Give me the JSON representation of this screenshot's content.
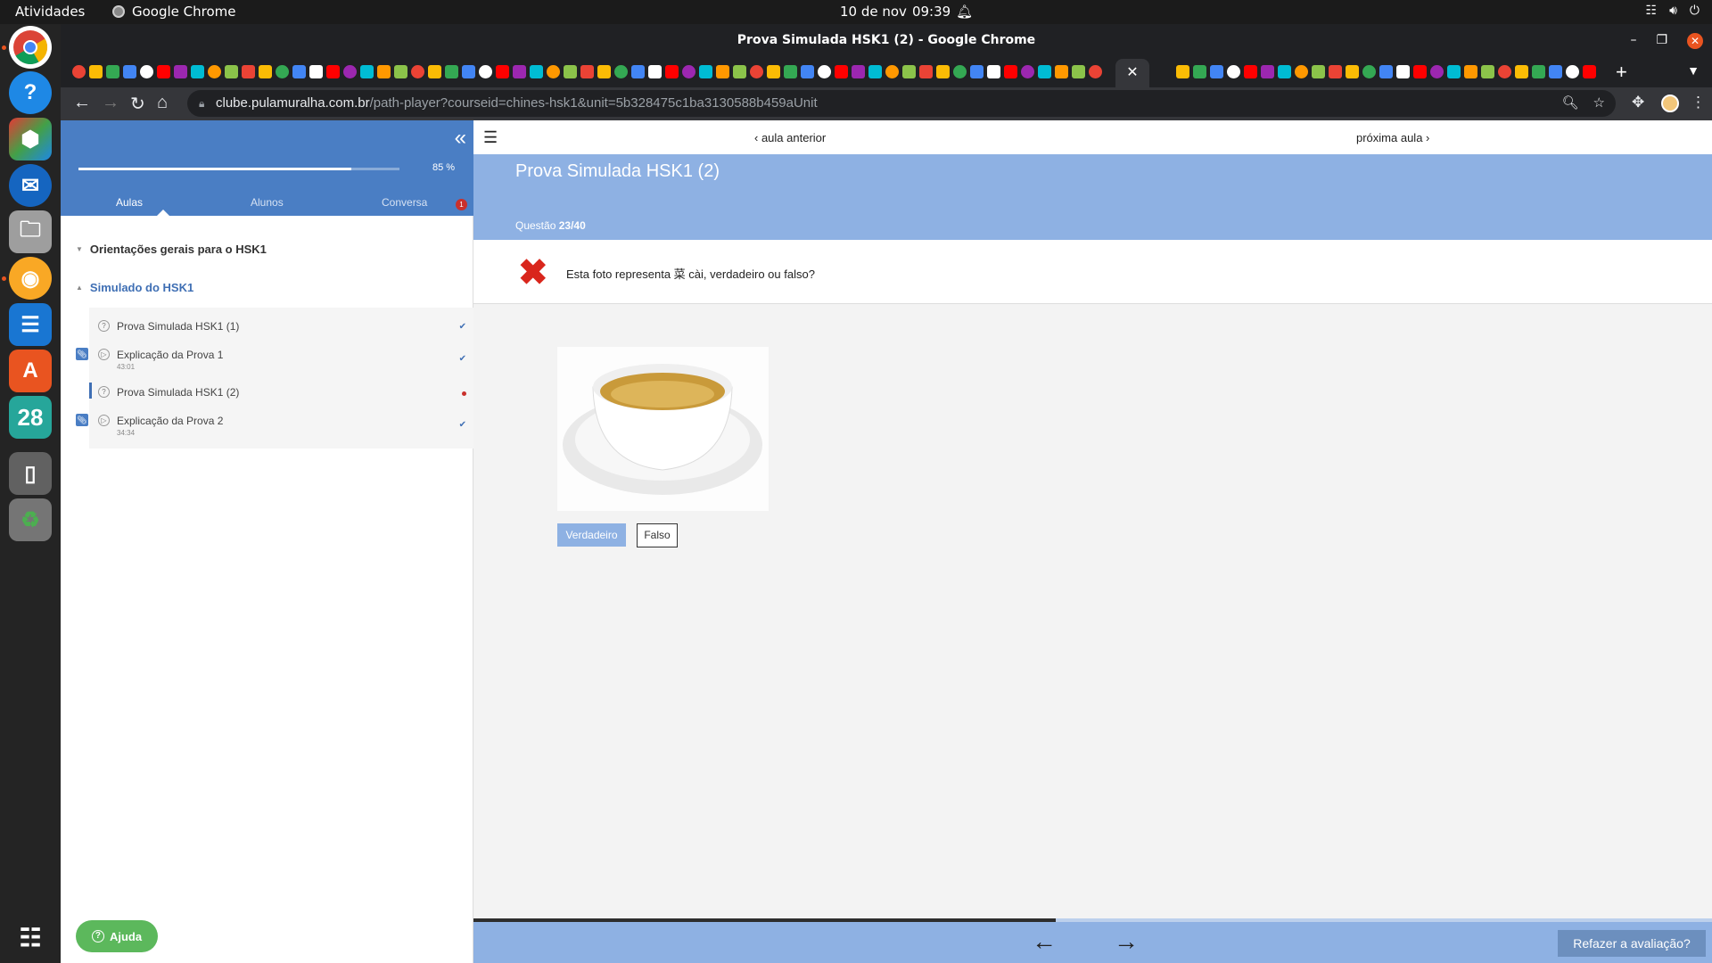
{
  "system": {
    "activities": "Atividades",
    "app_name": "Google Chrome",
    "date": "10 de nov",
    "time": "09:39"
  },
  "dock": {
    "calendar_day": "28"
  },
  "browser": {
    "window_title": "Prova Simulada HSK1 (2) - Google Chrome",
    "url_host": "clube.pulamuralha.com.br",
    "url_path": "/path-player?courseid=chines-hsk1&unit=5b328475c1ba3130588b459aUnit"
  },
  "sidebar": {
    "progress": {
      "percent_label": "85 %",
      "fraction": 0.85
    },
    "tabs": [
      {
        "label": "Aulas",
        "active": true
      },
      {
        "label": "Alunos",
        "active": false
      },
      {
        "label": "Conversa",
        "active": false
      }
    ],
    "badge": "1",
    "sections": [
      {
        "label": "Orientações gerais para o HSK1"
      },
      {
        "label": "Simulado do HSK1"
      }
    ],
    "lessons": [
      {
        "title": "Prova Simulada HSK1 (1)",
        "duration": "",
        "status": "done"
      },
      {
        "title": "Explicação da Prova 1",
        "duration": "43:01",
        "status": "done"
      },
      {
        "title": "Prova Simulada HSK1 (2)",
        "duration": "",
        "status": "current"
      },
      {
        "title": "Explicação da Prova 2",
        "duration": "34:34",
        "status": "done"
      }
    ],
    "help_label": "Ajuda"
  },
  "main": {
    "prev_label": "aula anterior",
    "next_label": "próxima aula",
    "quiz_title": "Prova Simulada HSK1 (2)",
    "question_label": "Questão",
    "question_number": "23/40",
    "question_text": "Esta foto representa 菜 cài, verdadeiro ou falso?",
    "answer_state": "wrong",
    "options": [
      {
        "label": "Verdadeiro",
        "selected": true
      },
      {
        "label": "Falso",
        "selected": false
      }
    ],
    "bottom_progress_fraction": 0.47,
    "retake_label": "Refazer a avaliação?"
  },
  "colors": {
    "sidebar_header": "#4a7ec4",
    "banner": "#8eb1e3",
    "wrong": "#d9261c",
    "help": "#5cb85c"
  }
}
